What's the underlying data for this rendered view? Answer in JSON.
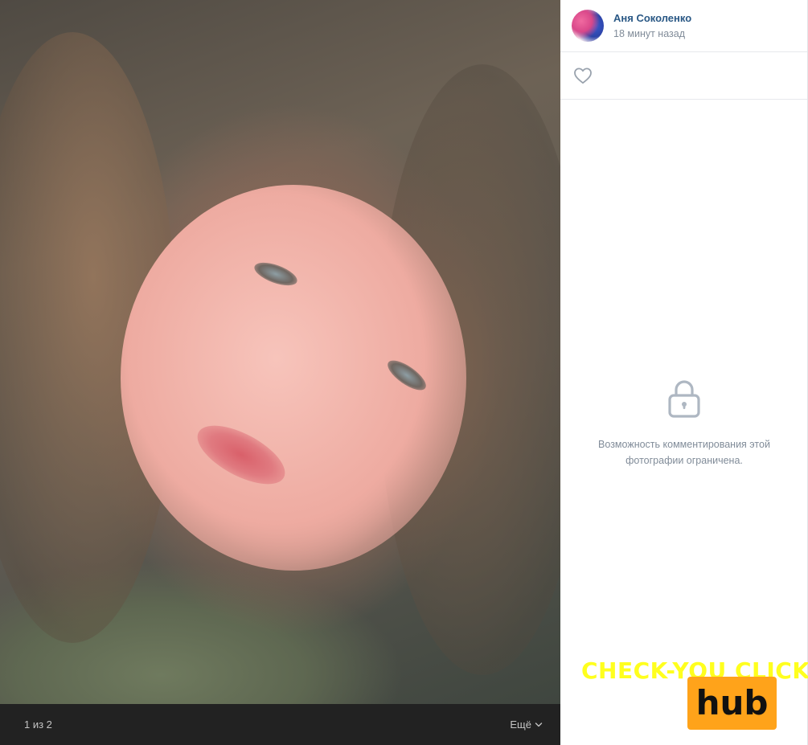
{
  "photo": {
    "counter": "1 из 2",
    "more_label": "Ещё"
  },
  "author": {
    "name": "Аня Соколенко",
    "time": "18 минут назад"
  },
  "comments": {
    "locked_message_line1": "Возможность комментирования этой",
    "locked_message_line2": "фотографии ограничена."
  },
  "watermark": {
    "text": "CHECK-YOU CLICK",
    "badge": "hub"
  },
  "icons": {
    "like": "heart-outline-icon",
    "lock": "lock-icon",
    "more": "chevron-down-icon"
  },
  "colors": {
    "link": "#2a5885",
    "secondary_text": "#818c99",
    "footer_bg": "#222222",
    "watermark_text": "#ffff1e",
    "watermark_badge": "#ffa31a"
  }
}
